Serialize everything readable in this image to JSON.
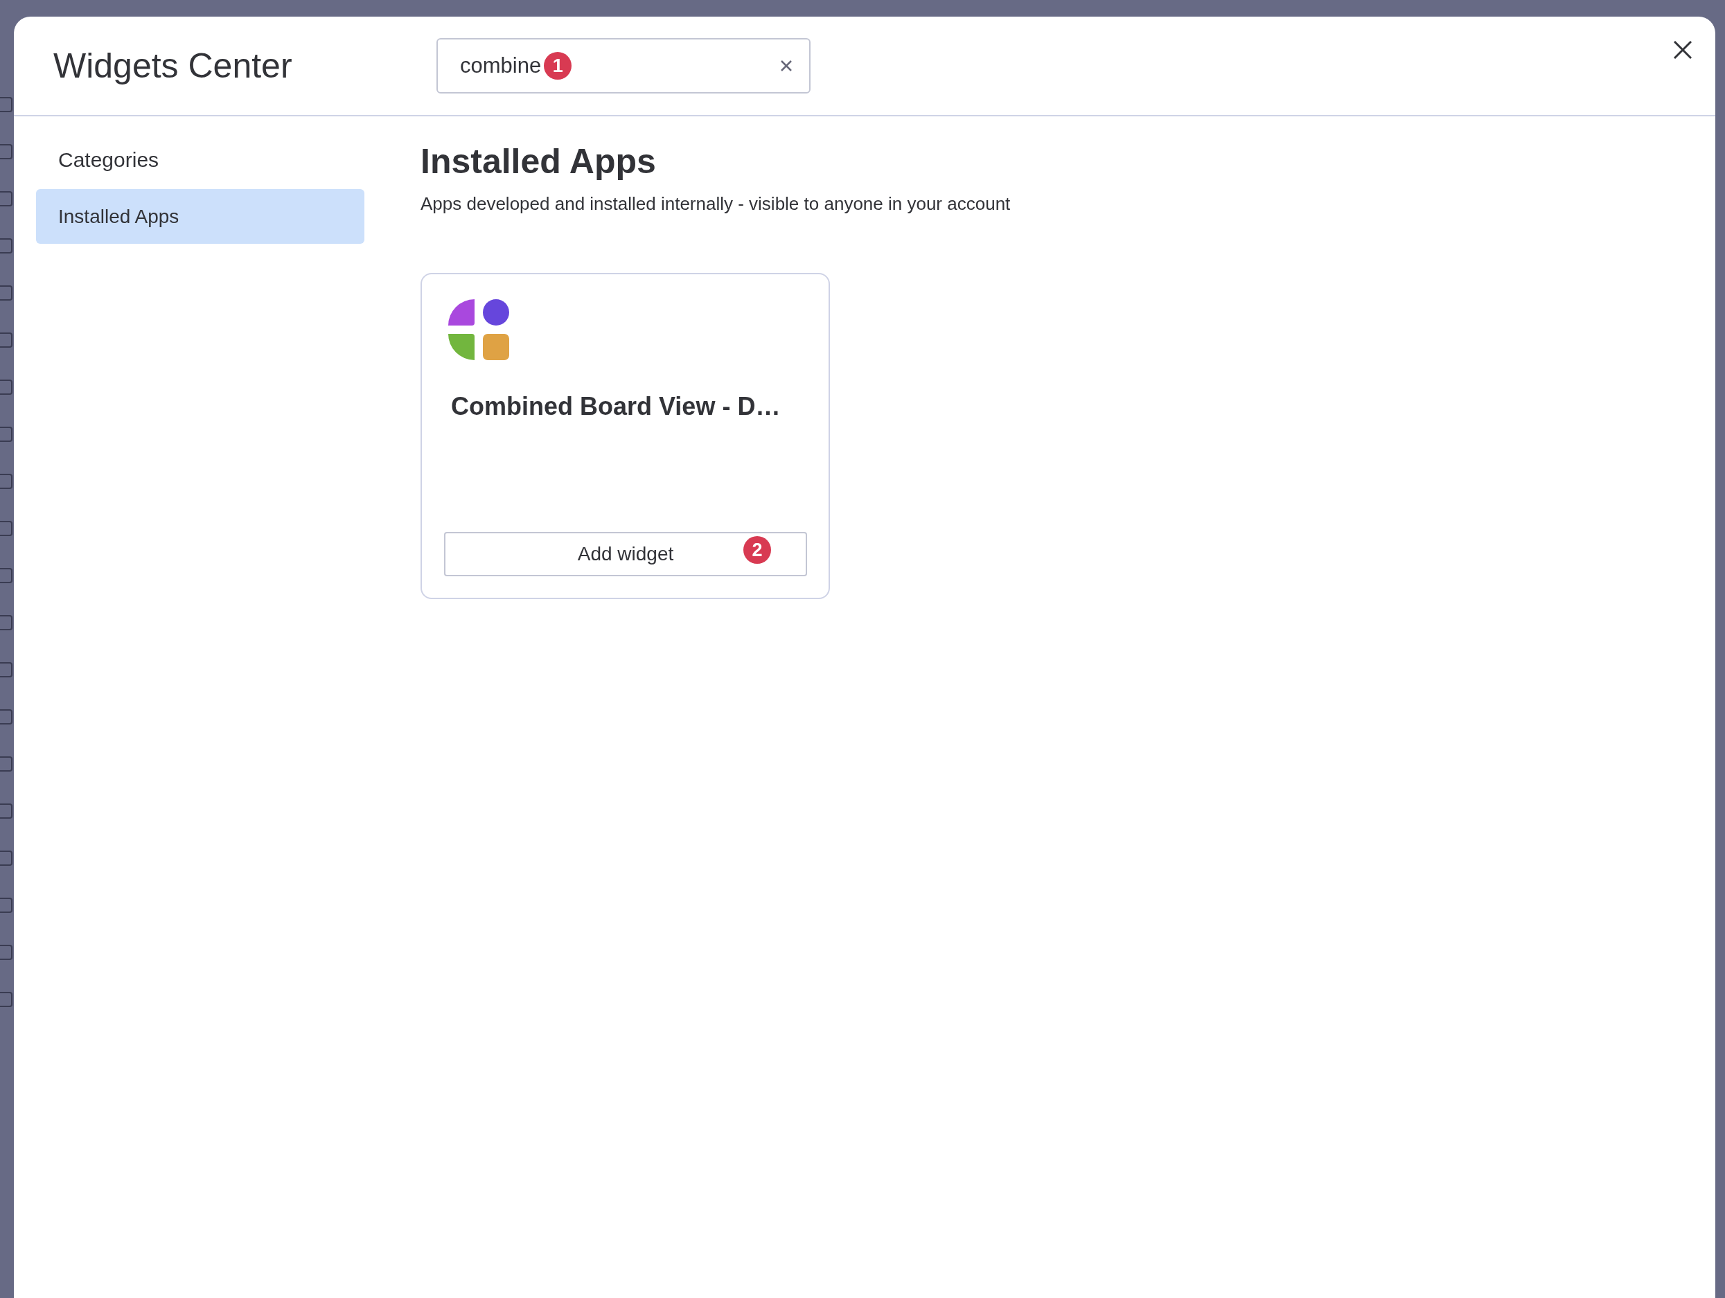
{
  "dialog": {
    "title": "Widgets Center"
  },
  "search": {
    "value": "combine",
    "marker": "1"
  },
  "sidebar": {
    "heading": "Categories",
    "items": [
      {
        "label": "Installed Apps",
        "selected": true
      }
    ]
  },
  "section": {
    "title": "Installed Apps",
    "description": "Apps developed and installed internally - visible to anyone in your account"
  },
  "apps": [
    {
      "name": "Combined Board View - D…",
      "button": "Add widget",
      "marker": "2"
    }
  ]
}
